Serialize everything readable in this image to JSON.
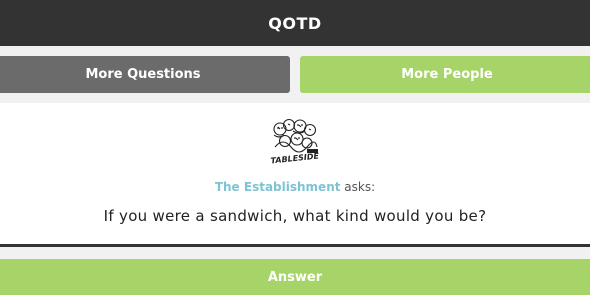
{
  "header": {
    "title": "QOTD"
  },
  "actions": {
    "more_questions_label": "More Questions",
    "more_people_label": "More People"
  },
  "question_card": {
    "logo_text": "TABLESIDE",
    "asker_name": "The Establishment",
    "asker_suffix": " asks:",
    "question_text": "If you were a sandwich, what kind would you be?"
  },
  "footer": {
    "answer_label": "Answer"
  },
  "colors": {
    "header_bg": "#333333",
    "primary_green": "#a6d468",
    "secondary_gray": "#6b6b6b",
    "asker_link": "#7ec3d4"
  }
}
